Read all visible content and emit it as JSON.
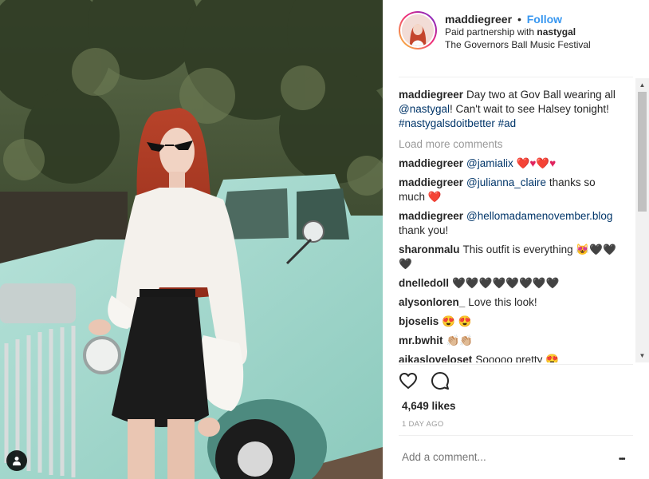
{
  "header": {
    "username": "maddiegreer",
    "separator": "•",
    "follow_label": "Follow",
    "partnership_prefix": "Paid partnership with ",
    "partner": "nastygal",
    "location": "The Governors Ball Music Festival"
  },
  "caption": {
    "username": "maddiegreer",
    "text_1": "Day two at Gov Ball wearing all ",
    "mention": "@nastygal",
    "text_2": "! Can't wait to see Halsey tonight! ",
    "hashtag_1": "#nastygalsdoitbetter",
    "hashtag_2": "#ad"
  },
  "load_more": "Load more comments",
  "comments": [
    {
      "username": "maddiegreer",
      "mention": "@jamialix",
      "text": "",
      "emoji": "❤️♥❤️♥"
    },
    {
      "username": "maddiegreer",
      "mention": "@julianna_claire",
      "text": " thanks so much ",
      "emoji": "❤️"
    },
    {
      "username": "maddiegreer",
      "mention": "@hellomadamenovember.blog",
      "text": " thank you!",
      "emoji": ""
    },
    {
      "username": "sharonmalu",
      "mention": "",
      "text": "This outfit is everything ",
      "emoji": "😻🖤🖤🖤"
    },
    {
      "username": "dnelledoll",
      "mention": "",
      "text": "",
      "emoji": "🖤🖤🖤🖤🖤🖤🖤🖤"
    },
    {
      "username": "alysonloren_",
      "mention": "",
      "text": "Love this look!",
      "emoji": ""
    },
    {
      "username": "bjoselis",
      "mention": "",
      "text": "",
      "emoji": "😍 😍"
    },
    {
      "username": "mr.bwhit",
      "mention": "",
      "text": "",
      "emoji": "👏🏼👏🏼"
    },
    {
      "username": "aikasloveloset",
      "mention": "",
      "text": "Sooooo pretty ",
      "emoji": "😍"
    }
  ],
  "likes": "4,649 likes",
  "time": "1 DAY AGO",
  "add_comment_placeholder": "Add a comment...",
  "more_label": "•••",
  "icons": {
    "like": "heart-outline-icon",
    "comment": "speech-bubble-icon",
    "tag": "person-tag-icon",
    "more": "ellipsis-icon"
  },
  "colors": {
    "follow": "#3897f0",
    "link": "#003569",
    "muted": "#999999",
    "truck": "#9fd6cc"
  }
}
